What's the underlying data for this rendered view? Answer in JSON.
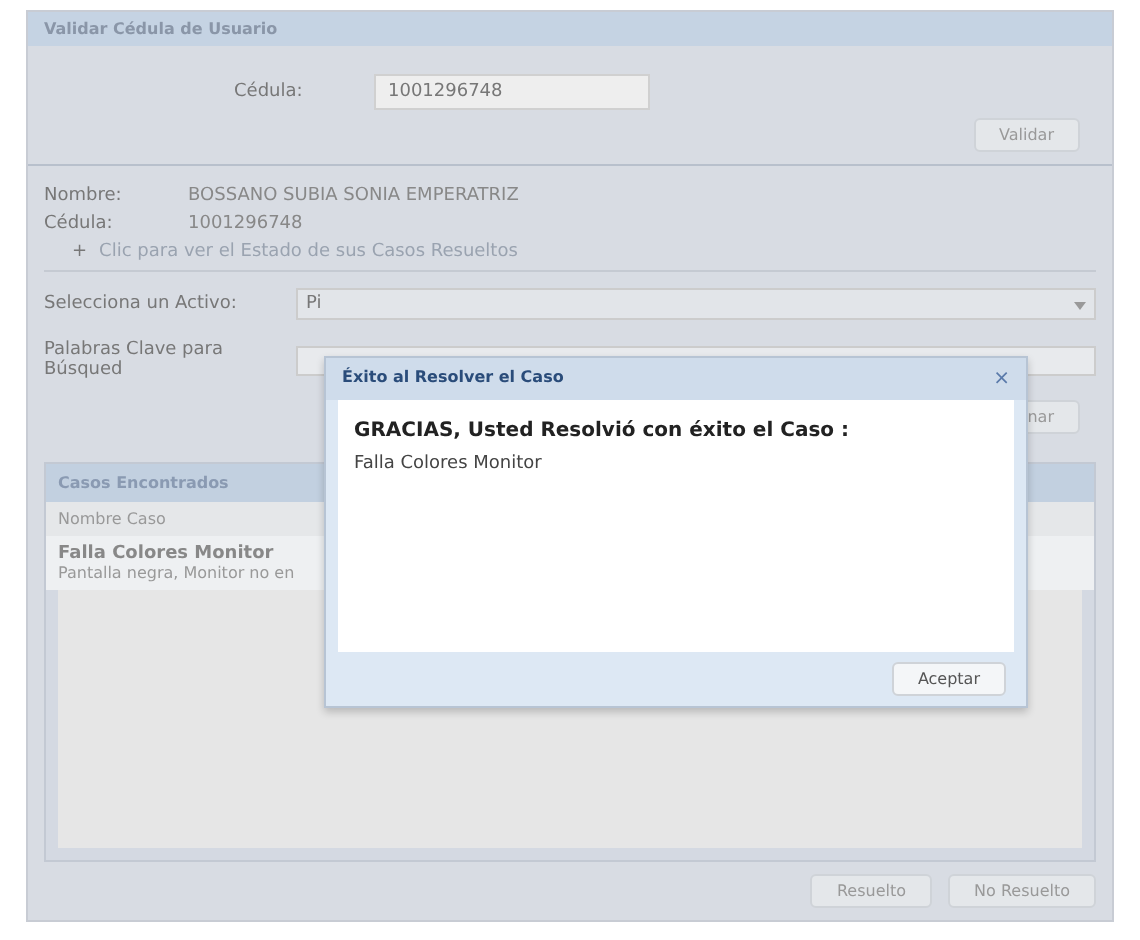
{
  "panel": {
    "title": "Validar Cédula de Usuario",
    "cedula_label": "Cédula:",
    "cedula_value": "1001296748",
    "validate_button": "Validar"
  },
  "user": {
    "name_label": "Nombre:",
    "name": "BOSSANO SUBIA SONIA EMPERATRIZ",
    "cedula_label": "Cédula:",
    "cedula": "1001296748",
    "link_icon": "+",
    "link": "Clic para ver el Estado de sus Casos Resueltos"
  },
  "search": {
    "asset_label": "Selecciona un Activo:",
    "asset_value": "Pi",
    "keywords_label": "Palabras Clave para Búsqued",
    "search_button": "nar"
  },
  "cases": {
    "title": "Casos Encontrados",
    "column": "Nombre Caso",
    "rows": [
      {
        "title": "Falla Colores Monitor",
        "detail": "Pantalla negra, Monitor no en"
      }
    ]
  },
  "buttons": [
    "Resuelto",
    "No Resuelto"
  ],
  "dialog": {
    "title": "Éxito al Resolver el Caso",
    "close": "×",
    "message": "GRACIAS, Usted Resolvió con éxito el Caso :",
    "case": "Falla Colores Monitor",
    "ok": "Aceptar"
  }
}
